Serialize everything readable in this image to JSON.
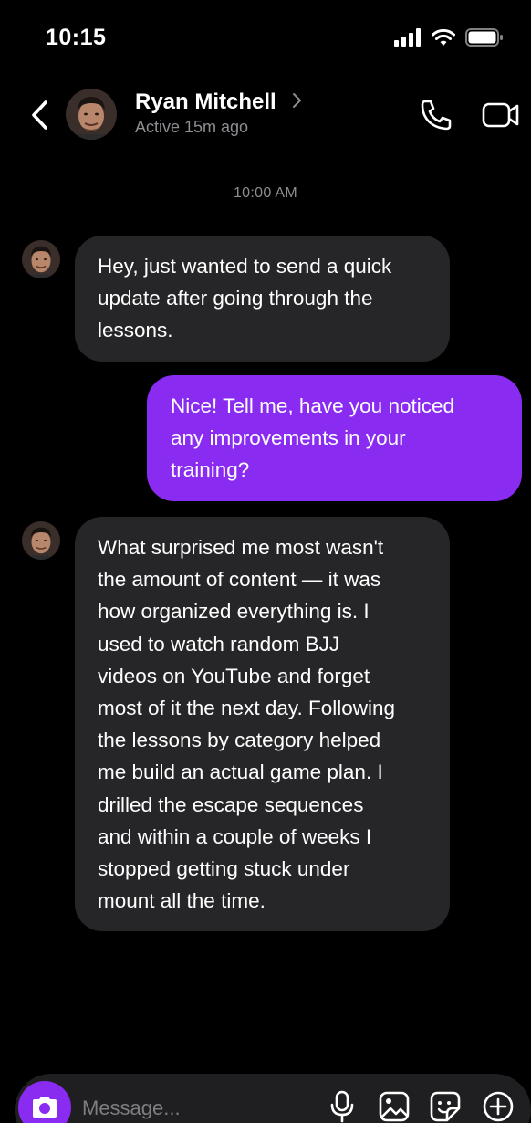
{
  "status_bar": {
    "time": "10:15",
    "icons": [
      "cellular-signal-icon",
      "wifi-icon",
      "battery-icon"
    ]
  },
  "header": {
    "contact_name": "Ryan Mitchell",
    "contact_status": "Active 15m ago",
    "icons": [
      "back-chevron-icon",
      "chevron-right-icon",
      "phone-icon",
      "video-camera-icon"
    ]
  },
  "conversation": {
    "timestamp": "10:00 AM",
    "messages": [
      {
        "direction": "incoming",
        "text": "Hey, just wanted to send a quick\nupdate after going through the\nlessons."
      },
      {
        "direction": "outgoing",
        "text": "Nice! Tell me, have you noticed\nany improvements in your\ntraining?"
      },
      {
        "direction": "incoming",
        "text": "What surprised me most wasn't\nthe amount of content — it was\nhow organized everything is. I\nused to watch random BJJ\nvideos on YouTube and forget\nmost of it the next day. Following\nthe lessons by category helped\nme build an actual game plan. I\ndrilled the escape sequences\nand within a couple of weeks I\nstopped getting stuck under\nmount all the time."
      }
    ]
  },
  "composer": {
    "placeholder": "Message...",
    "icons": [
      "camera-icon",
      "microphone-icon",
      "gallery-icon",
      "sticker-icon",
      "plus-circle-icon"
    ]
  },
  "colors": {
    "background": "#000000",
    "incoming_bubble": "#262628",
    "outgoing_bubble": "#8a2bf2",
    "muted_text": "#8d8d93"
  }
}
